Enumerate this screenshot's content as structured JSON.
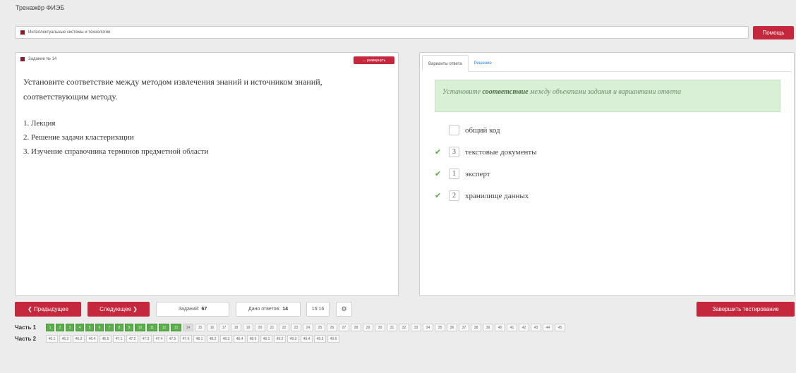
{
  "app": {
    "title": "Тренажёр ФИЭБ"
  },
  "subject": {
    "text": "Интеллектуальные системы и технологии",
    "help_label": "Помощь"
  },
  "task": {
    "header": "Задание № 14",
    "expand_label": "↔ развернуть",
    "question_line1": "Установите соответствие между методом извлечения знаний и источником знаний,",
    "question_line2": "соответствующим методу.",
    "items": [
      "1. Лекция",
      "2. Решение задачи кластеризации",
      "3. Изучение справочника терминов предметной области"
    ]
  },
  "tabs": {
    "answers": "Варианты ответа",
    "solution": "Решение"
  },
  "hint": {
    "prefix": "Установите ",
    "bold": "соответствие",
    "suffix": " между объектами задания и вариантами ответа"
  },
  "options": [
    {
      "value": "",
      "text": "общий код",
      "checked": false
    },
    {
      "value": "3",
      "text": "текстовые документы",
      "checked": true
    },
    {
      "value": "1",
      "text": "эксперт",
      "checked": true
    },
    {
      "value": "2",
      "text": "хранилище данных",
      "checked": true
    }
  ],
  "controls": {
    "prev": "❮ Предыдущее",
    "next": "Следующее ❯",
    "tasks_label": "Заданий:",
    "tasks_count": "67",
    "answers_label": "Дано ответов:",
    "answers_count": "14",
    "timer": "16:16",
    "finish": "Завершить тестирование"
  },
  "parts": {
    "part1_label": "Часть 1",
    "part2_label": "Часть 2",
    "part1_cells": [
      "1",
      "2",
      "3",
      "4",
      "5",
      "6",
      "7",
      "8",
      "9",
      "10",
      "11",
      "12",
      "13",
      "14",
      "15",
      "16",
      "17",
      "18",
      "19",
      "20",
      "21",
      "22",
      "23",
      "24",
      "25",
      "26",
      "27",
      "28",
      "29",
      "30",
      "31",
      "32",
      "33",
      "34",
      "35",
      "36",
      "37",
      "38",
      "39",
      "40",
      "41",
      "42",
      "43",
      "44",
      "45"
    ],
    "part1_done_count": 13,
    "part1_current": "14",
    "part2_cells": [
      "46.1",
      "46.2",
      "46.3",
      "46.4",
      "46.5",
      "47.1",
      "47.2",
      "47.3",
      "47.4",
      "47.5",
      "47.6",
      "48.1",
      "48.2",
      "48.3",
      "48.4",
      "48.5",
      "49.1",
      "49.2",
      "49.3",
      "49.4",
      "49.5",
      "49.6"
    ]
  },
  "colors": {
    "accent_red": "#c5283d",
    "done_green": "#5aad4a"
  }
}
